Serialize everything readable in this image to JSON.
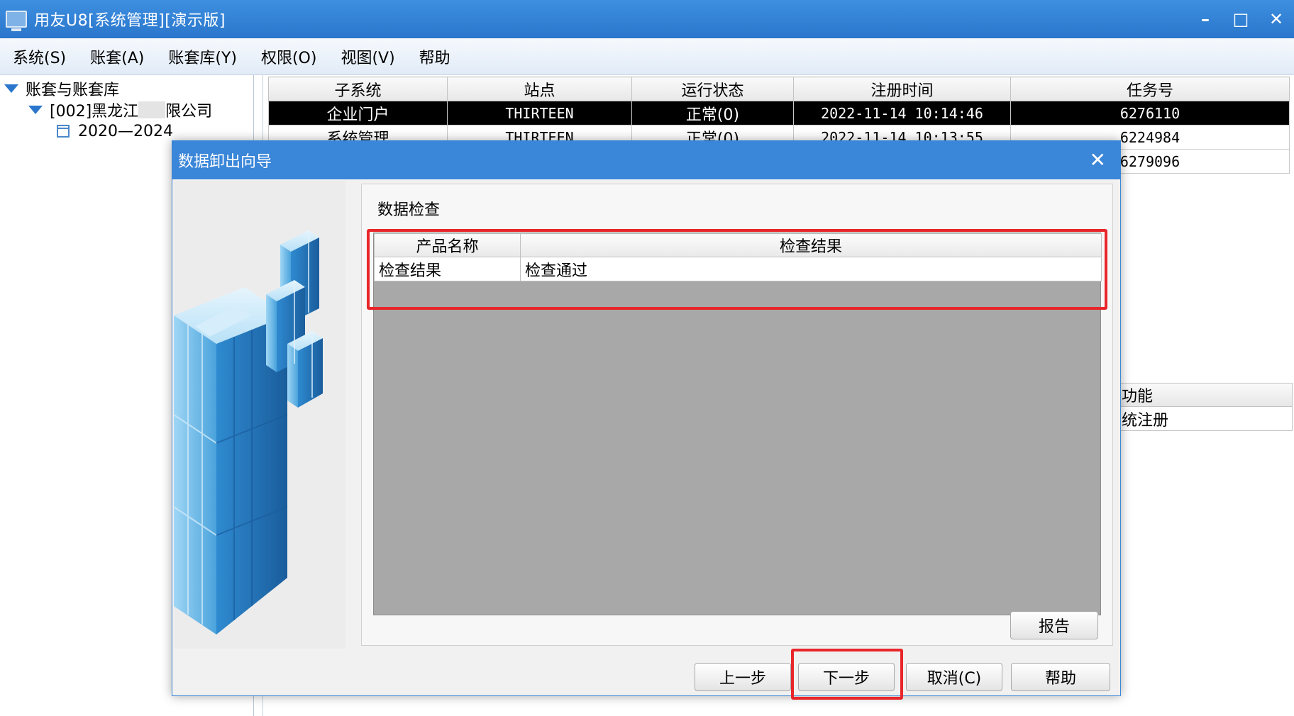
{
  "window": {
    "title": "用友U8[系统管理][演示版]",
    "controls": {
      "minimize": "–",
      "maximize": "□",
      "close": "✕"
    }
  },
  "menu": [
    "系统(S)",
    "账套(A)",
    "账套库(Y)",
    "权限(O)",
    "视图(V)",
    "帮助"
  ],
  "tree": {
    "root": "账套与账套库",
    "account_prefix": "[002]黑龙江",
    "account_suffix": "限公司",
    "year_range": "2020—2024"
  },
  "process_table": {
    "headers": [
      "子系统",
      "站点",
      "运行状态",
      "注册时间",
      "任务号"
    ],
    "rows": [
      [
        "企业门户",
        "THIRTEEN",
        "正常(0)",
        "2022-11-14 10:14:46",
        "6276110"
      ],
      [
        "系统管理",
        "THIRTEEN",
        "正常(0)",
        "2022-11-14 10:13:55",
        "6224984"
      ],
      [
        "",
        "",
        "",
        "",
        "6279096"
      ]
    ]
  },
  "right_partial_rows": [
    "功能",
    "统注册"
  ],
  "dialog": {
    "title": "数据卸出向导",
    "close": "✕",
    "group_title": "数据检查",
    "result_headers": [
      "产品名称",
      "检查结果"
    ],
    "result_rows": [
      [
        "检查结果",
        "检查通过"
      ]
    ],
    "buttons": {
      "report": "报告",
      "prev": "上一步",
      "next": "下一步",
      "cancel": "取消(C)",
      "help": "帮助"
    }
  },
  "colors": {
    "titlebar": "#2f7fd6",
    "highlight": "#e8262a",
    "selected_row": "#000000"
  }
}
